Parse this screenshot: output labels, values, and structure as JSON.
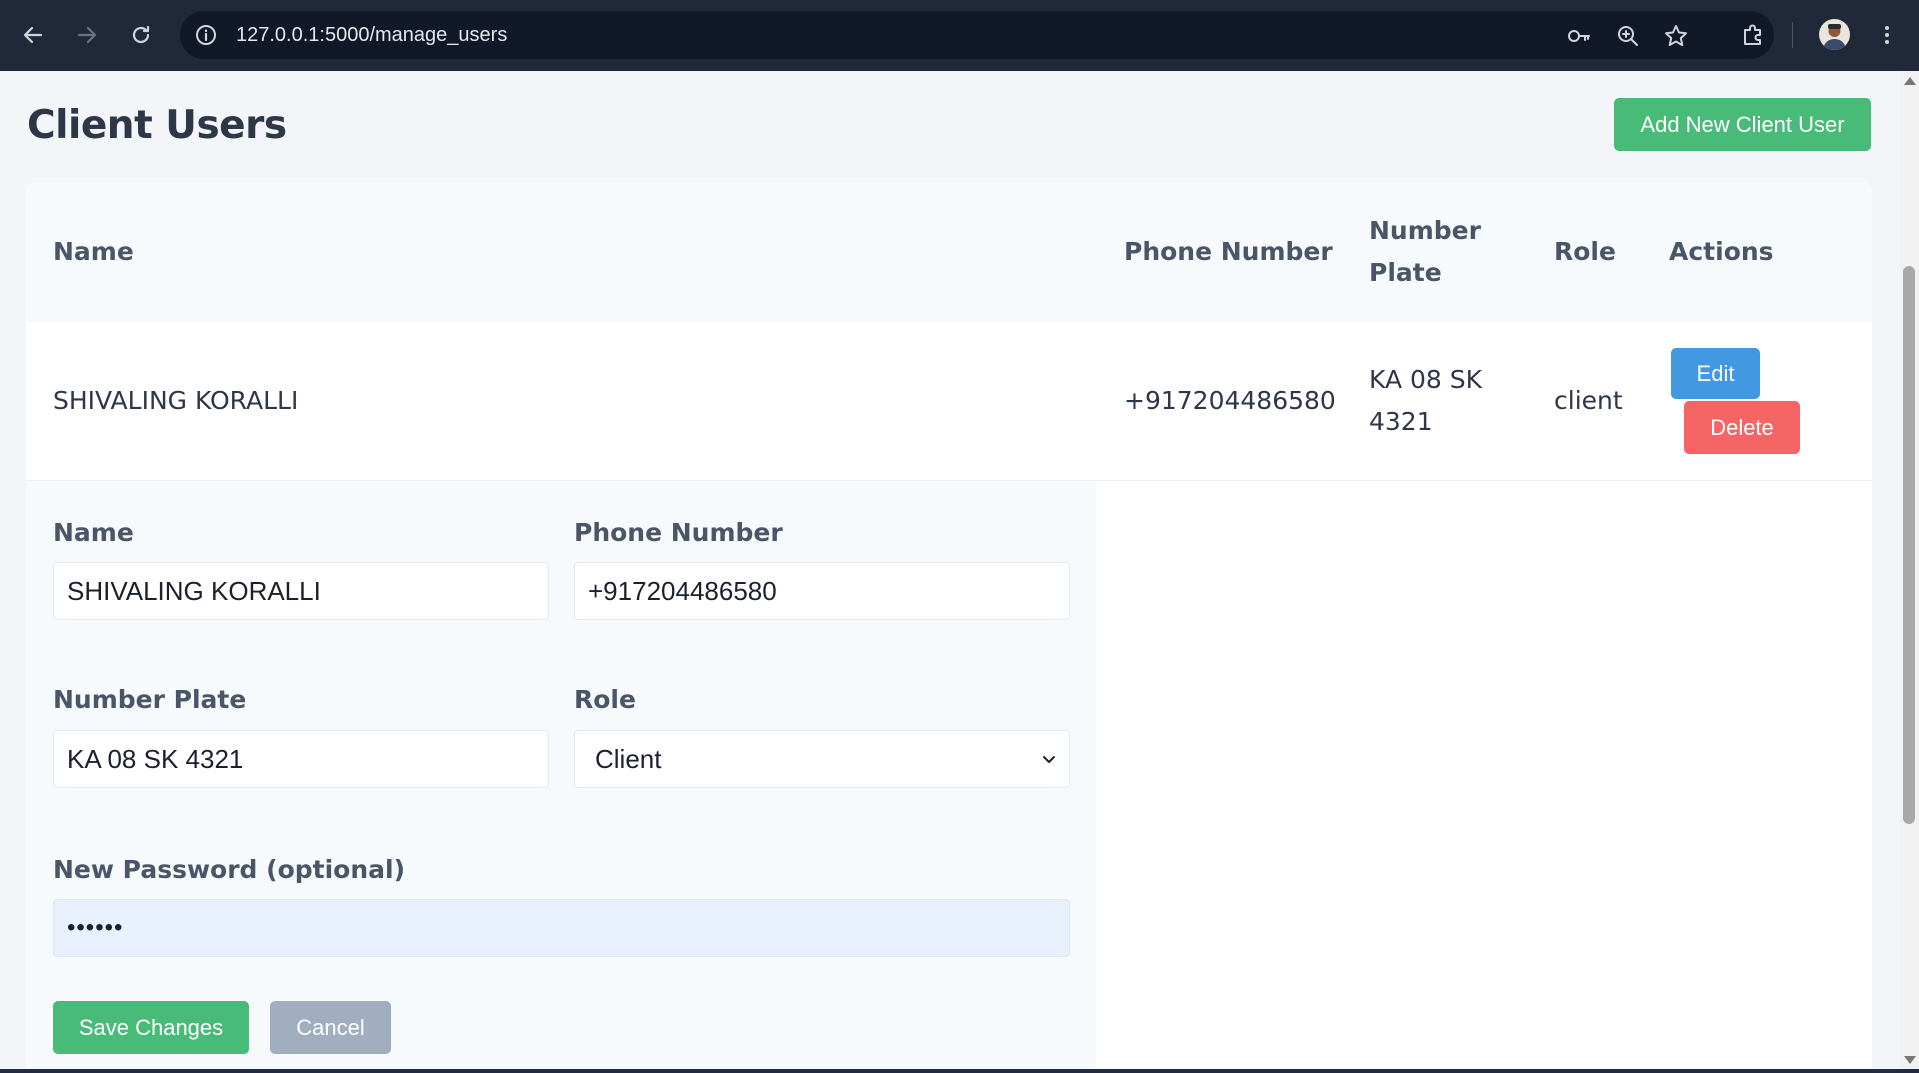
{
  "browser": {
    "url": "127.0.0.1:5000/manage_users"
  },
  "page": {
    "title": "Client Users",
    "add_button": "Add New Client User"
  },
  "table": {
    "headers": {
      "name": "Name",
      "phone": "Phone Number",
      "plate_line1": "Number",
      "plate_line2": "Plate",
      "role": "Role",
      "actions": "Actions"
    },
    "rows": [
      {
        "name": "SHIVALING KORALLI",
        "phone": "+917204486580",
        "plate_line1": "KA 08 SK",
        "plate_line2": "4321",
        "role": "client",
        "edit_label": "Edit",
        "delete_label": "Delete"
      }
    ]
  },
  "edit_form": {
    "name_label": "Name",
    "name_value": "SHIVALING KORALLI",
    "phone_label": "Phone Number",
    "phone_value": "+917204486580",
    "plate_label": "Number Plate",
    "plate_value": "KA 08 SK 4321",
    "role_label": "Role",
    "role_value": "Client",
    "password_label": "New Password (optional)",
    "password_value": "••••••",
    "save_label": "Save Changes",
    "cancel_label": "Cancel"
  },
  "icons": {
    "back": "arrow-left-icon",
    "forward": "arrow-right-icon",
    "reload": "reload-icon",
    "info": "info-icon",
    "key": "key-icon",
    "zoom": "zoom-icon",
    "bookmark": "star-icon",
    "extensions": "puzzle-icon",
    "menu": "kebab-menu-icon"
  },
  "colors": {
    "green": "#48bb78",
    "blue": "#4299e1",
    "red": "#f56565",
    "gray": "#a0aec0"
  }
}
